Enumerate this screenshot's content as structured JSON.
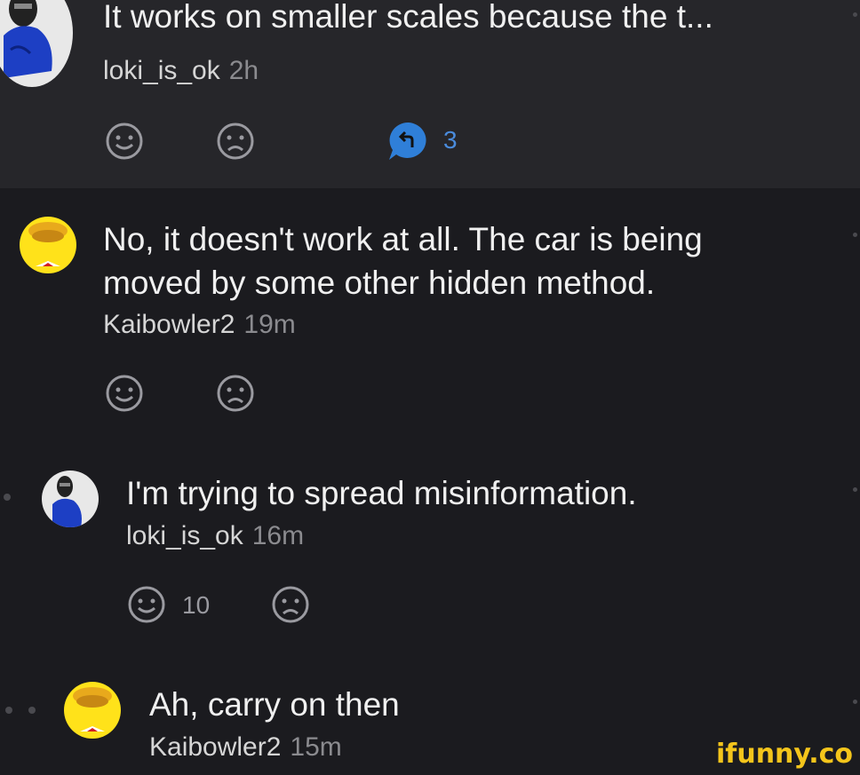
{
  "comments": [
    {
      "text": "It works on smaller scales because the t...",
      "author": "loki_is_ok",
      "time": "2h",
      "reply_count": "3"
    },
    {
      "text_line1": "No, it doesn't work at all. The car is being",
      "text_line2": "moved by some other hidden method.",
      "author": "Kaibowler2",
      "time": "19m"
    },
    {
      "text": "I'm trying to spread misinformation.",
      "author": "loki_is_ok",
      "time": "16m",
      "smile_count": "10"
    },
    {
      "text": "Ah, carry on then",
      "author": "Kaibowler2",
      "time": "15m"
    }
  ],
  "watermark": "ifunny.co",
  "colors": {
    "reply_accent": "#2f7fd8",
    "background": "#1b1b1f",
    "top_block": "#26262a",
    "watermark": "#f4c51b"
  },
  "icons": [
    "smile-icon",
    "sad-icon",
    "reply-icon"
  ]
}
